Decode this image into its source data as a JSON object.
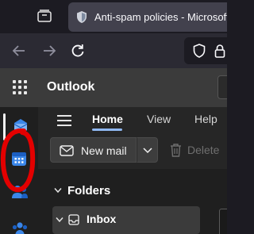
{
  "browser": {
    "active_tab": {
      "title": "Anti-spam policies - Microsoft",
      "favicon": "shield-favicon"
    },
    "nav": {
      "back_icon": "arrow-left-icon",
      "forward_icon": "arrow-right-icon",
      "reload_icon": "reload-icon"
    },
    "urlbar": {
      "icons": [
        "shield-icon",
        "lock-icon"
      ]
    }
  },
  "outlook": {
    "header": {
      "app_title": "Outlook"
    },
    "app_rail": {
      "items": [
        {
          "name": "Mail",
          "icon": "mail-icon",
          "selected": true
        },
        {
          "name": "Calendar",
          "icon": "calendar-icon",
          "selected": false
        },
        {
          "name": "People",
          "icon": "people-icon",
          "selected": false
        },
        {
          "name": "Groups",
          "icon": "groups-icon",
          "selected": false
        }
      ]
    },
    "ribbon": {
      "tabs": [
        {
          "label": "Home",
          "active": true
        },
        {
          "label": "View",
          "active": false
        },
        {
          "label": "Help",
          "active": false
        }
      ]
    },
    "toolbar": {
      "new_mail_label": "New mail",
      "delete_label": "Delete"
    },
    "folders": {
      "header_label": "Folders",
      "items": [
        {
          "label": "Inbox",
          "selected": true
        }
      ]
    }
  },
  "colors": {
    "accent": "#3a86e8",
    "annotation_red": "#e30000",
    "header_bg": "#3b3b3b",
    "rail_bg": "#1f1f1f"
  }
}
